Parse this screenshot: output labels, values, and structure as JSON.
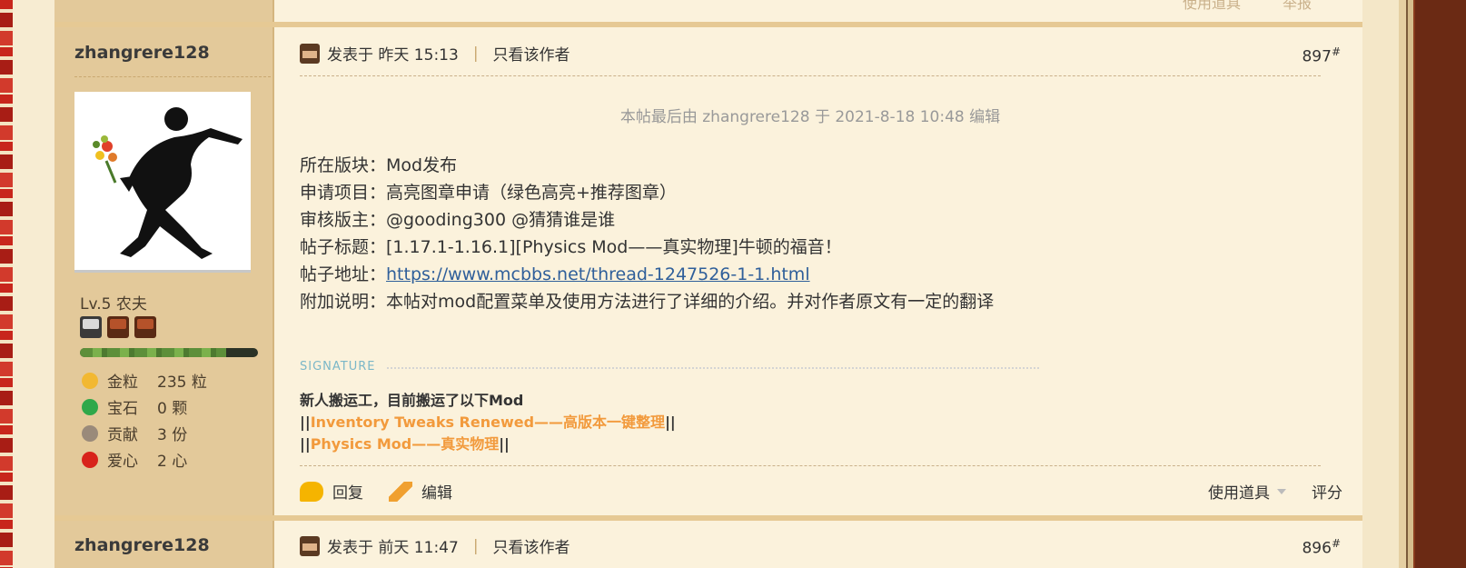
{
  "prev_post": {
    "tools_label": "使用道具",
    "report_label": "举报"
  },
  "post": {
    "username": "zhangrere128",
    "level": "Lv.5 农夫",
    "xp_fraction": 0.82,
    "stats": [
      {
        "label": "金粒",
        "value": "235 粒",
        "icon": "gold-nugget-icon",
        "color": "#f2b832"
      },
      {
        "label": "宝石",
        "value": "0 颗",
        "icon": "emerald-icon",
        "color": "#2fa84a"
      },
      {
        "label": "贡献",
        "value": "3 份",
        "icon": "contribution-icon",
        "color": "#9a8a7a"
      },
      {
        "label": "爱心",
        "value": "2 心",
        "icon": "apple-icon",
        "color": "#d8231b"
      }
    ],
    "posted_prefix": "发表于 昨天 15:13",
    "only_author": "只看该作者",
    "floor_num": "897",
    "floor_mark": "#",
    "edit_note": "本帖最后由 zhangrere128 于 2021-8-18 10:48 编辑",
    "lines": [
      {
        "label": "所在版块：",
        "value": "Mod发布"
      },
      {
        "label": "申请项目：",
        "value": "高亮图章申请（绿色高亮+推荐图章）"
      },
      {
        "label": "审核版主：",
        "value": "@gooding300 @猜猜谁是谁"
      },
      {
        "label": "帖子标题：",
        "value": "[1.17.1-1.16.1][Physics Mod——真实物理]牛顿的福音！"
      },
      {
        "label": "帖子地址：",
        "link": "https://www.mcbbs.net/thread-1247526-1-1.html"
      },
      {
        "label": "附加说明：",
        "value": "本帖对mod配置菜单及使用方法进行了详细的介绍。并对作者原文有一定的翻译"
      }
    ],
    "signature_label": "SIGNATURE",
    "signature": {
      "line1": "新人搬运工，目前搬运了以下Mod",
      "bar": "||",
      "mod1": "Inventory Tweaks Renewed——高版本一键整理",
      "mod2": "Physics Mod——真实物理"
    },
    "reply": "回复",
    "edit": "编辑",
    "tools": "使用道具",
    "rate": "评分"
  },
  "next_post": {
    "username": "zhangrere128",
    "posted_prefix": "发表于 前天 11:47",
    "only_author": "只看该作者",
    "floor_num": "896",
    "floor_mark": "#"
  },
  "colors": {
    "accent_orange": "#f29a3c",
    "link_blue": "#2f5f9a"
  }
}
